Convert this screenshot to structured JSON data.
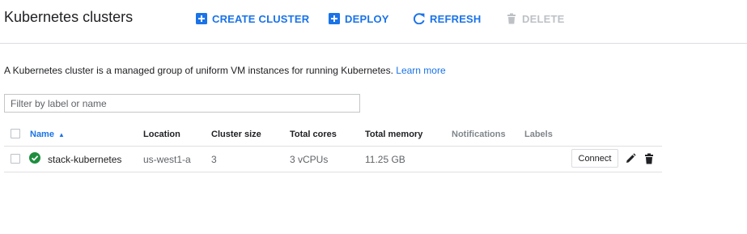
{
  "header": {
    "title": "Kubernetes clusters",
    "actions": {
      "create": {
        "label": "CREATE CLUSTER",
        "icon": "add-box-icon"
      },
      "deploy": {
        "label": "DEPLOY",
        "icon": "add-box-icon"
      },
      "refresh": {
        "label": "REFRESH",
        "icon": "refresh-icon"
      },
      "delete": {
        "label": "DELETE",
        "icon": "trash-icon",
        "disabled": true
      }
    }
  },
  "description": {
    "text": "A Kubernetes cluster is a managed group of uniform VM instances for running Kubernetes.",
    "link": "Learn more"
  },
  "filter": {
    "placeholder": "Filter by label or name",
    "value": ""
  },
  "table": {
    "columns": {
      "name": "Name",
      "location": "Location",
      "size": "Cluster size",
      "cores": "Total cores",
      "memory": "Total memory",
      "notifications": "Notifications",
      "labels": "Labels"
    },
    "sort_indicator": "▲",
    "rows": [
      {
        "status": "ok",
        "name": "stack-kubernetes",
        "location": "us-west1-a",
        "size": "3",
        "cores": "3 vCPUs",
        "memory": "11.25 GB",
        "connect_label": "Connect"
      }
    ]
  },
  "colors": {
    "accent": "#1a73e8",
    "status_ok": "#1e8e3e",
    "disabled": "#bdc1c6"
  }
}
